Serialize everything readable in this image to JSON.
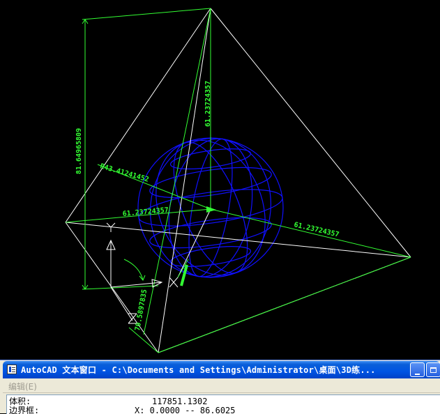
{
  "text_window": {
    "title": "AutoCAD 文本窗口 - C:\\Documents and Settings\\Administrator\\桌面\\3D练...",
    "menu": {
      "edit": "编辑(E)"
    },
    "lines": [
      {
        "label": "体积:",
        "value": "117851.1302"
      },
      {
        "label": "边界框:",
        "value": "X: 0.0000  --  86.6025"
      }
    ]
  },
  "drawing": {
    "dimensions": [
      "81.64965809",
      "61.23724357",
      "R43.41241452",
      "61.23724357",
      "61.23724357",
      "70.5897835"
    ],
    "ucs_labels": {
      "x": "X",
      "y": "Y",
      "z": "Z"
    },
    "colors": {
      "background": "#000000",
      "edges": "#ffffff",
      "dimensions": "#33ff33",
      "sphere": "#1010ff",
      "ucs_icon": "#ffffff"
    }
  }
}
